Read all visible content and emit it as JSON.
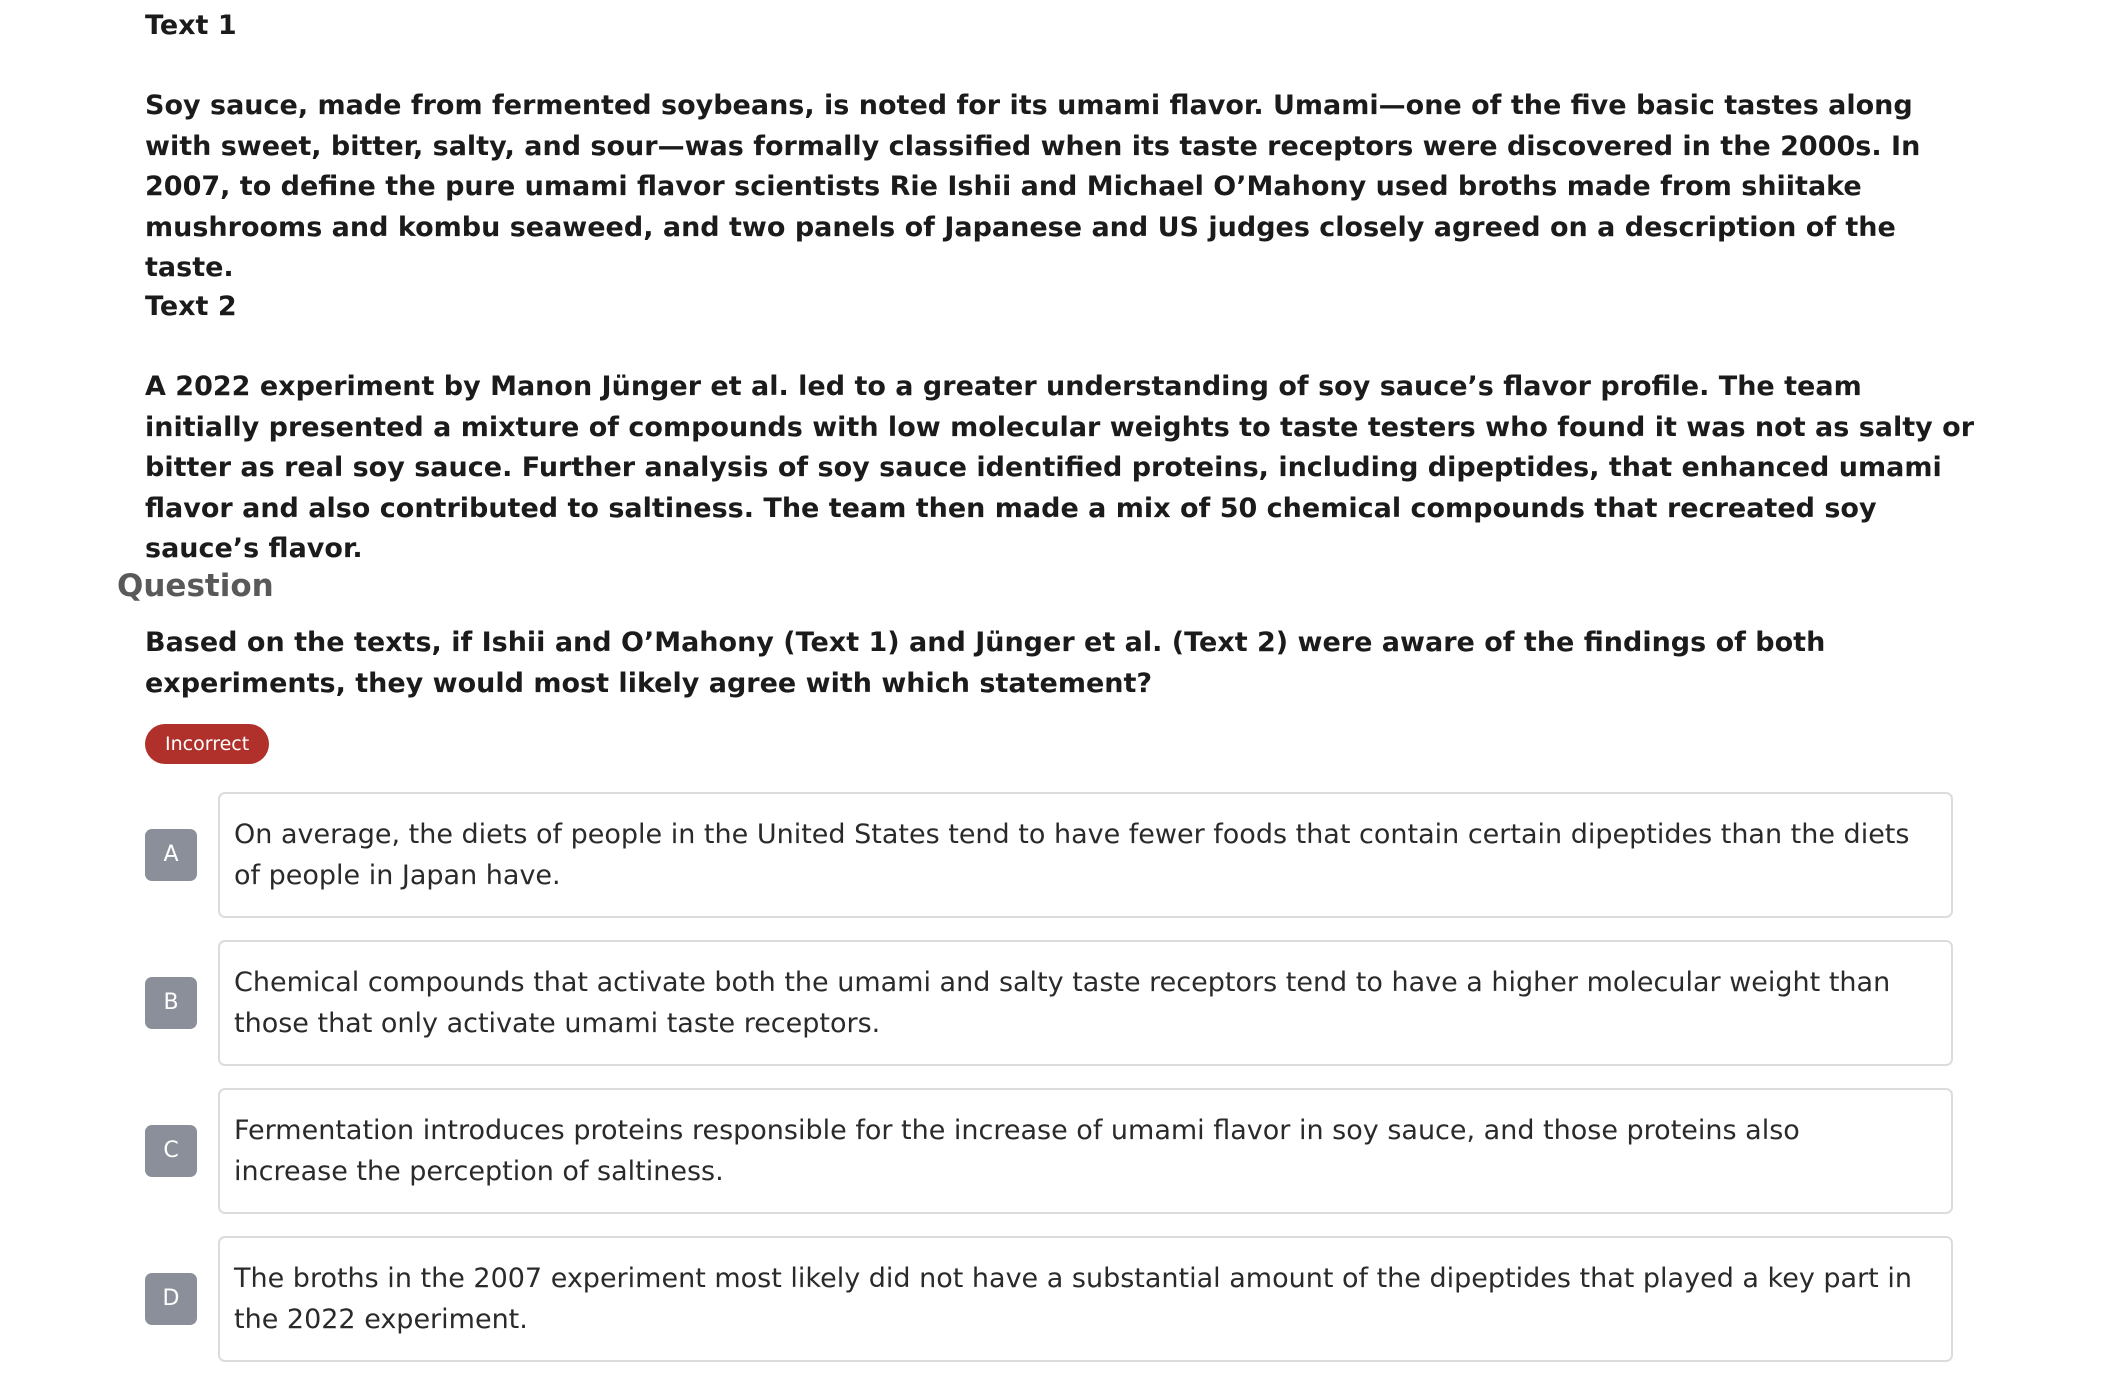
{
  "passages": {
    "text1": {
      "heading": "Text 1",
      "body": "Soy sauce, made from fermented soybeans, is noted for its umami flavor. Umami—one of the five basic tastes along with sweet, bitter, salty, and sour—was formally classified when its taste receptors were discovered in the 2000s. In 2007, to define the pure umami flavor scientists Rie Ishii and Michael O’Mahony used broths made from shiitake mushrooms and kombu seaweed, and two panels of Japanese and US judges closely agreed on a description of the taste."
    },
    "text2": {
      "heading": "Text 2",
      "body": "A 2022 experiment by Manon Jünger et al. led to a greater understanding of soy sauce’s flavor profile. The team initially presented a mixture of compounds with low molecular weights to taste testers who found it was not as salty or bitter as real soy sauce. Further analysis of soy sauce identified proteins, including dipeptides, that enhanced umami flavor and also contributed to saltiness. The team then made a mix of 50 chemical compounds that recreated soy sauce’s flavor."
    }
  },
  "question": {
    "heading": "Question",
    "stem": "Based on the texts, if Ishii and O’Mahony (Text 1) and Jünger et al. (Text 2) were aware of the findings of both experiments, they would most likely agree with which statement?",
    "status_badge": "Incorrect",
    "status_color": "#b0312b"
  },
  "choices": [
    {
      "letter": "A",
      "text": "On average, the diets of people in the United States tend to have fewer foods that contain certain dipeptides than the diets of people in Japan have."
    },
    {
      "letter": "B",
      "text": "Chemical compounds that activate both the umami and salty taste receptors tend to have a higher molecular weight than those that only activate umami taste receptors."
    },
    {
      "letter": "C",
      "text": "Fermentation introduces proteins responsible for the increase of umami flavor in soy sauce, and those proteins also increase the perception of saltiness."
    },
    {
      "letter": "D",
      "text": "The broths in the 2007 experiment most likely did not have a substantial amount of the dipeptides that played a key part in the 2022 experiment."
    }
  ]
}
